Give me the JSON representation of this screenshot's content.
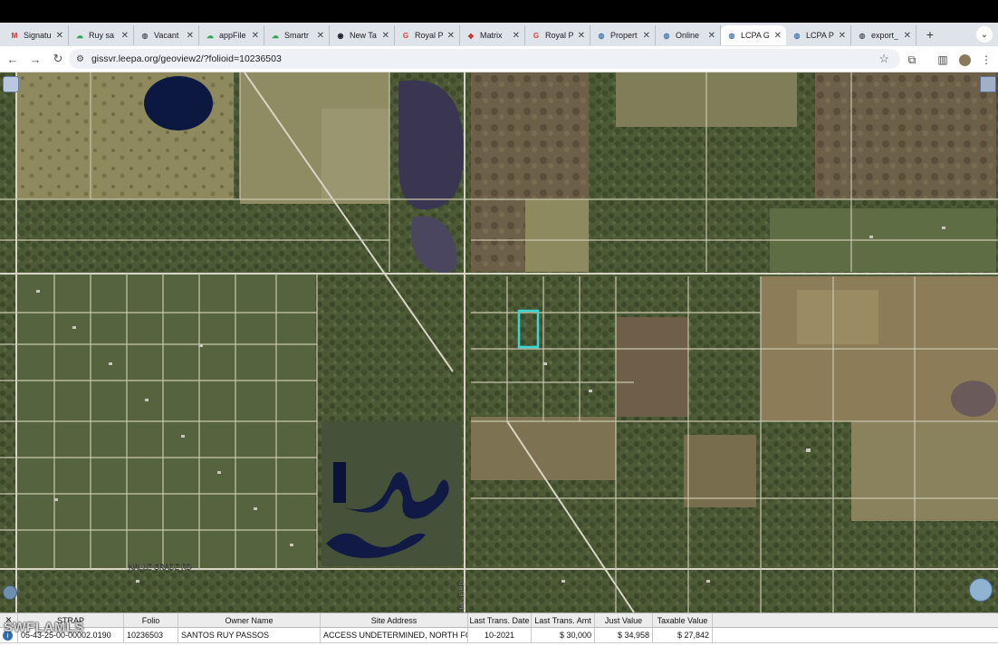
{
  "browser": {
    "tabs": [
      {
        "title": "Signatu",
        "favicon": "gmail-icon",
        "color": "#d93025",
        "glyph": "M"
      },
      {
        "title": "Ruy sa",
        "favicon": "cloud-icon",
        "color": "#34a853",
        "glyph": "☁"
      },
      {
        "title": "Vacant",
        "favicon": "globe-icon",
        "color": "#5f6368",
        "glyph": "◍"
      },
      {
        "title": "appFile",
        "favicon": "cloud-icon",
        "color": "#34a853",
        "glyph": "☁"
      },
      {
        "title": "Smartr",
        "favicon": "cloud-icon",
        "color": "#34a853",
        "glyph": "☁"
      },
      {
        "title": "New Ta",
        "favicon": "chrome-icon",
        "color": "#202124",
        "glyph": "◉"
      },
      {
        "title": "Royal P",
        "favicon": "royal-icon",
        "color": "#e8453c",
        "glyph": "G"
      },
      {
        "title": "Matrix",
        "favicon": "matrix-icon",
        "color": "#c0392b",
        "glyph": "◆"
      },
      {
        "title": "Royal P",
        "favicon": "royal-icon",
        "color": "#e8453c",
        "glyph": "G"
      },
      {
        "title": "Propert",
        "favicon": "earth-icon",
        "color": "#4a7bb0",
        "glyph": "◍"
      },
      {
        "title": "Online",
        "favicon": "earth-icon",
        "color": "#4a7bb0",
        "glyph": "◍"
      },
      {
        "title": "LCPA G",
        "favicon": "earth-icon",
        "color": "#4a7bb0",
        "glyph": "◍",
        "active": true
      },
      {
        "title": "LCPA P",
        "favicon": "earth-icon",
        "color": "#4a7bb0",
        "glyph": "◍"
      },
      {
        "title": "export_",
        "favicon": "globe-icon",
        "color": "#5f6368",
        "glyph": "◍"
      }
    ],
    "new_tab_glyph": "+",
    "url": "gissvr.leepa.org/geoview2/?folioid=10236503"
  },
  "map": {
    "road_labels": {
      "nalle_grade": "NALLE GRADE RD",
      "vertical": "NALLE RD"
    },
    "highlight_color": "#3ad6d6"
  },
  "table": {
    "headers": [
      "STRAP",
      "Folio",
      "Owner Name",
      "Site Address",
      "Last Trans. Date",
      "Last Trans. Amt",
      "Just Value",
      "Taxable Value"
    ],
    "row": {
      "strap": "05-43-25-00-00002.0190",
      "folio": "10236503",
      "owner": "SANTOS RUY PASSOS",
      "address": "ACCESS UNDETERMINED, NORTH FORT...",
      "date": "10-2021",
      "amt": "$ 30,000",
      "just": "$ 34,958",
      "taxable": "$ 27,842"
    }
  },
  "watermark": "SWFLAMLS"
}
